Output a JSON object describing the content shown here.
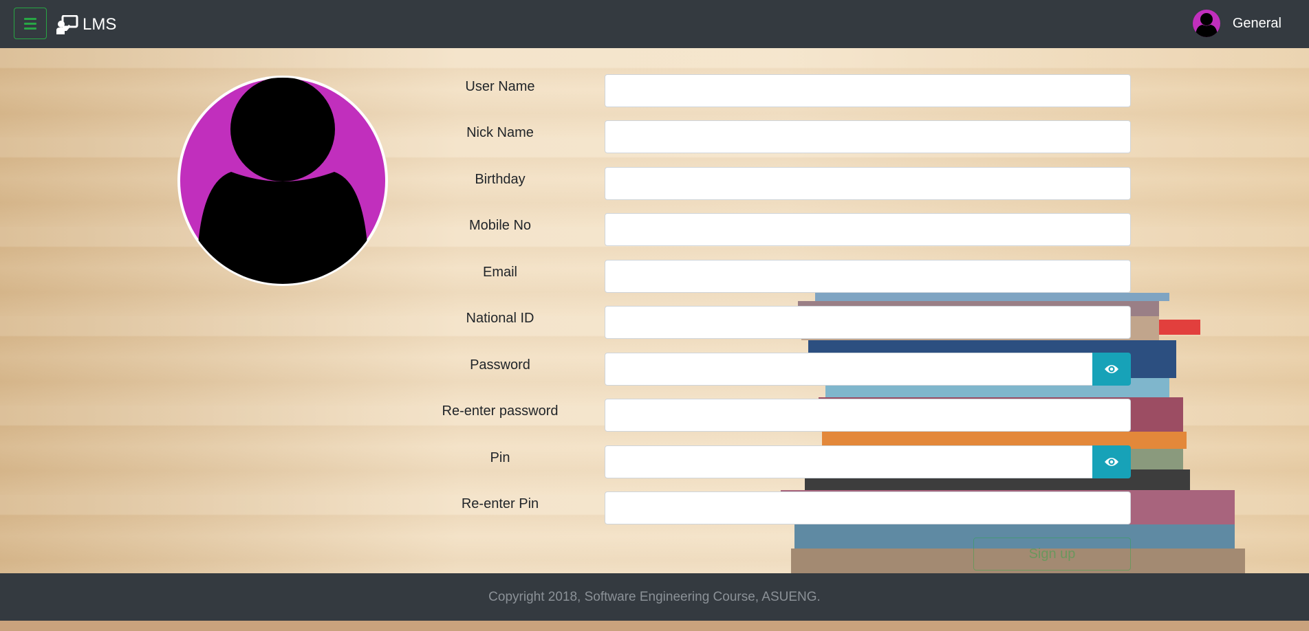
{
  "navbar": {
    "brand": "LMS",
    "brand_icon": "chalkboard-teacher-icon",
    "menu_icon": "hamburger-icon",
    "user_name": "General",
    "user_avatar_color": "#c12fbd"
  },
  "profile": {
    "avatar_bg_color": "#c12fbd",
    "avatar_icon": "user-silhouette-icon"
  },
  "form": {
    "fields": [
      {
        "label": "User Name",
        "value": "",
        "placeholder": ""
      },
      {
        "label": "Nick Name",
        "value": "",
        "placeholder": ""
      },
      {
        "label": "Birthday",
        "value": "",
        "placeholder": ""
      },
      {
        "label": "Mobile No",
        "value": "",
        "placeholder": ""
      },
      {
        "label": "Email",
        "value": "",
        "placeholder": ""
      },
      {
        "label": "National ID",
        "value": "",
        "placeholder": ""
      },
      {
        "label": "Password",
        "value": "",
        "placeholder": "",
        "toggle_icon": "eye-icon"
      },
      {
        "label": "Re-enter password",
        "value": "",
        "placeholder": ""
      },
      {
        "label": "Pin",
        "value": "",
        "placeholder": "",
        "toggle_icon": "eye-icon"
      },
      {
        "label": "Re-enter Pin",
        "value": "",
        "placeholder": ""
      }
    ],
    "submit_label": "Sign up"
  },
  "footer": {
    "copyright": "Copyright 2018, Software Engineering Course, ASUENG."
  },
  "colors": {
    "navbar_bg": "#343a40",
    "success": "#28a745",
    "info": "#17a2b8"
  }
}
